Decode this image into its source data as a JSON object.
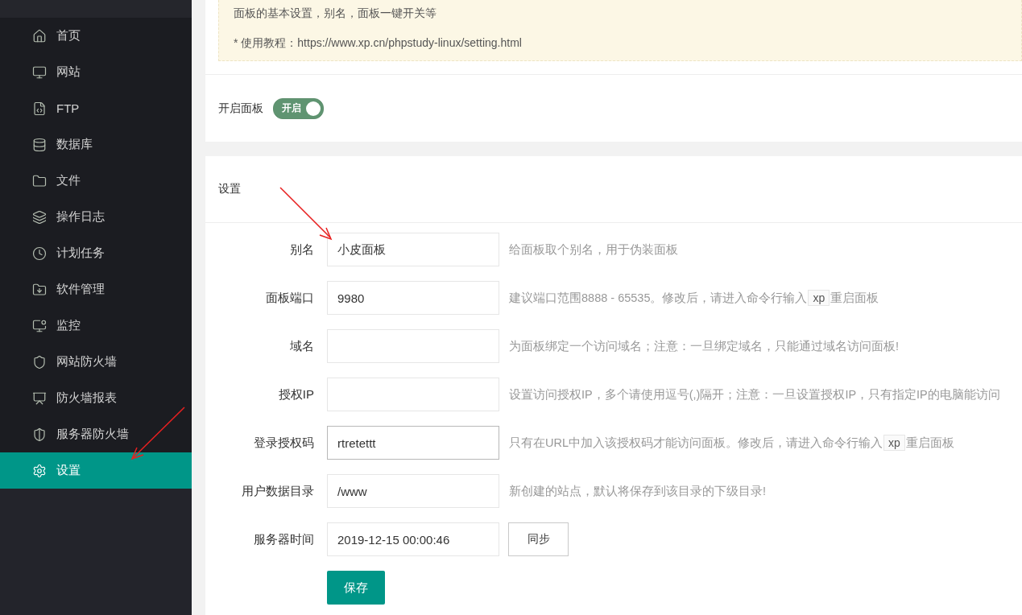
{
  "sidebar": {
    "items": [
      {
        "label": "首页",
        "selected": false
      },
      {
        "label": "网站",
        "selected": false
      },
      {
        "label": "FTP",
        "selected": false
      },
      {
        "label": "数据库",
        "selected": false
      },
      {
        "label": "文件",
        "selected": false
      },
      {
        "label": "操作日志",
        "selected": false
      },
      {
        "label": "计划任务",
        "selected": false
      },
      {
        "label": "软件管理",
        "selected": false
      },
      {
        "label": "监控",
        "selected": false
      },
      {
        "label": "网站防火墙",
        "selected": false
      },
      {
        "label": "防火墙报表",
        "selected": false
      },
      {
        "label": "服务器防火墙",
        "selected": false
      },
      {
        "label": "设置",
        "selected": true
      }
    ]
  },
  "notice": {
    "lines": [
      "面板的基本设置，别名，面板一键开关等",
      "* 使用教程：https://www.xp.cn/phpstudy-linux/setting.html"
    ]
  },
  "panel_switch": {
    "label": "开启面板",
    "toggle_text": "开启",
    "on": true
  },
  "settings": {
    "title": "设置",
    "fields": [
      {
        "label": "别名",
        "value": "小皮面板",
        "focused": false,
        "hint": [
          {
            "kind": "text",
            "text": "给面板取个别名，用于伪装面板"
          }
        ]
      },
      {
        "label": "面板端口",
        "value": "9980",
        "focused": false,
        "hint": [
          {
            "kind": "text",
            "text": "建议端口范围8888 - 65535。修改后，请进入命令行输入"
          },
          {
            "kind": "code",
            "text": "xp"
          },
          {
            "kind": "text",
            "text": "重启面板"
          }
        ]
      },
      {
        "label": "域名",
        "focused": false,
        "hint": [
          {
            "kind": "text",
            "text": "为面板绑定一个访问域名；注意：一旦绑定域名，只能通过域名访问面板!"
          }
        ]
      },
      {
        "label": "授权IP",
        "focused": false,
        "hint": [
          {
            "kind": "text",
            "text": "设置访问授权IP，多个请使用逗号(,)隔开；注意：一旦设置授权IP，只有指定IP的电脑能访问"
          }
        ]
      },
      {
        "label": "登录授权码",
        "value": "rtretettt",
        "focused": true,
        "hint": [
          {
            "kind": "text",
            "text": "只有在URL中加入该授权码才能访问面板。修改后，请进入命令行输入"
          },
          {
            "kind": "code",
            "text": "xp"
          },
          {
            "kind": "text",
            "text": "重启面板"
          }
        ]
      },
      {
        "label": "用户数据目录",
        "value": "/www",
        "focused": false,
        "hint": [
          {
            "kind": "text",
            "text": "新创建的站点，默认将保存到该目录的下级目录!"
          }
        ]
      },
      {
        "label": "服务器时间",
        "value": "2019-12-15 00:00:46",
        "focused": false,
        "button": "同步"
      }
    ],
    "save_button": "保存"
  }
}
